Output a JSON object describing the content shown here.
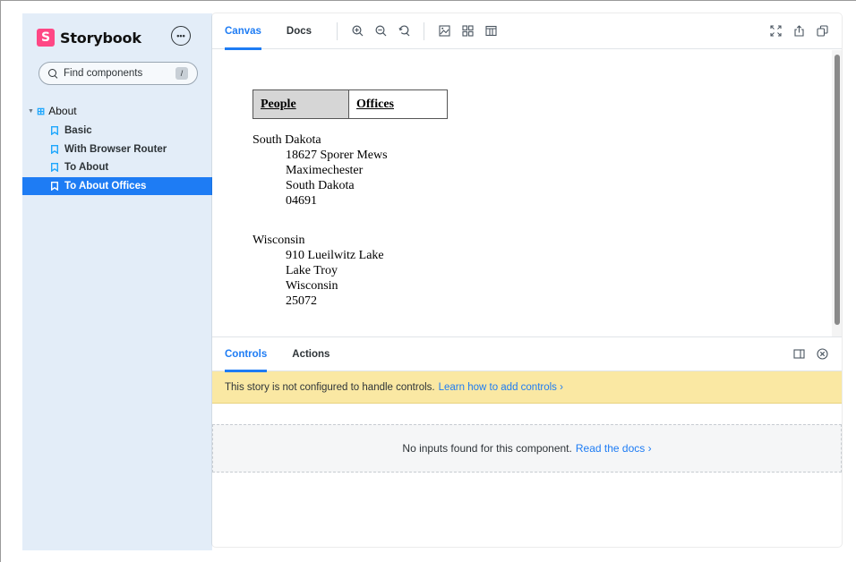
{
  "sidebar": {
    "brand": "Storybook",
    "brand_logo": "S",
    "menu_icon": "•••",
    "search": {
      "placeholder": "Find components",
      "shortcut": "/"
    },
    "tree": {
      "group": "About",
      "items": [
        {
          "label": "Basic"
        },
        {
          "label": "With Browser Router"
        },
        {
          "label": "To About"
        },
        {
          "label": "To About Offices"
        }
      ]
    }
  },
  "toolbar": {
    "tabs": [
      "Canvas",
      "Docs"
    ],
    "icons": [
      "zoom-in-icon",
      "zoom-out-icon",
      "zoom-reset-icon",
      "background-icon",
      "grid-icon",
      "outline-icon",
      "fullscreen-icon",
      "share-icon",
      "copy-link-icon"
    ]
  },
  "preview": {
    "nav": {
      "people": "People",
      "offices": "Offices"
    },
    "offices": [
      {
        "state": "South Dakota",
        "lines": [
          "18627 Sporer Mews",
          "Maximechester",
          "South Dakota",
          "04691"
        ]
      },
      {
        "state": "Wisconsin",
        "lines": [
          "910 Lueilwitz Lake",
          "Lake Troy",
          "Wisconsin",
          "25072"
        ]
      }
    ]
  },
  "addons": {
    "tabs": [
      "Controls",
      "Actions"
    ],
    "notice_text": "This story is not configured to handle controls.",
    "notice_link": "Learn how to add controls ›",
    "empty_text": "No inputs found for this component.",
    "empty_link": "Read the docs ›"
  },
  "colors": {
    "accent": "#1e7cf4",
    "sidebar_bg": "#e3edf8",
    "brand": "#ff4785",
    "notice_bg": "#fae8a3"
  }
}
